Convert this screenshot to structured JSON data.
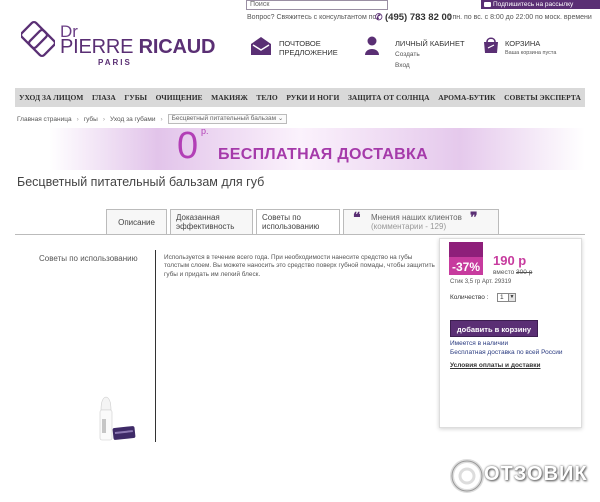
{
  "top": {
    "search_placeholder": "Поиск",
    "subscribe_label": "Подпишитесь на рассылку",
    "question": "Вопрос? Свяжитесь с консультантом по",
    "phone": "(495) 783 82 00",
    "hours": "с пн. по вс. с 8:00 до 22:00 по моск. времени"
  },
  "logo": {
    "dr": "Dr",
    "pierre": "PIERRE",
    "ricaud": "RICAUD",
    "paris": "PARIS"
  },
  "header_links": {
    "mail_line1": "ПОЧТОВОЕ",
    "mail_line2": "ПРЕДЛОЖЕНИЕ",
    "account_title": "ЛИЧНЫЙ КАБИНЕТ",
    "account_create": "Создать",
    "account_login": "Вход",
    "cart_title": "КОРЗИНА",
    "cart_status": "Ваша корзина пуста"
  },
  "nav": [
    "УХОД ЗА ЛИЦОМ",
    "ГЛАЗА",
    "ГУБЫ",
    "ОЧИЩЕНИЕ",
    "МАКИЯЖ",
    "ТЕЛО",
    "РУКИ И НОГИ",
    "ЗАЩИТА ОТ СОЛНЦА",
    "АРОМА-БУТИК",
    "СОВЕТЫ ЭКСПЕРТА"
  ],
  "breadcrumb": {
    "home": "Главная страница",
    "lips": "губы",
    "care": "Уход за губами",
    "current": "Бесцветный питательный бальзам"
  },
  "banner": {
    "zero": "0",
    "currency": "р.",
    "text": "БЕСПЛАТНАЯ ДОСТАВКА"
  },
  "product_title": "Бесцветный питательный бальзам для губ",
  "tabs": {
    "description": "Описание",
    "efficacy_1": "Доказанная",
    "efficacy_2": "эффективность",
    "advice_1": "Советы по",
    "advice_2": "использованию",
    "reviews_1": "Мнения наших клиентов",
    "reviews_2": "(комментарии - 129)"
  },
  "content": {
    "side_label": "Советы по использованию",
    "text": "Используется в течение всего года. При необходимости нанесите средство на губы толстым слоем. Вы можете наносить это средство поверх губной помады, чтобы защитить губы и придать им легкий блеск."
  },
  "price": {
    "discount": "-37%",
    "new_price": "190 р",
    "was_label": "вместо",
    "was_price": "300 р",
    "sku": "Стик 3,5 гр Арт. 29319",
    "qty_label": "Количество :",
    "qty_value": "1",
    "cart_button": "добавить в корзину",
    "stock": "Имеется в наличии",
    "delivery": "Бесплатная доставка по всей России",
    "terms": "Условия оплаты и доставки"
  },
  "watermark": "ОТЗОВИК",
  "colors": {
    "brand": "#5a2f74",
    "accent": "#c73b9e",
    "banner_text": "#a53aaa"
  }
}
